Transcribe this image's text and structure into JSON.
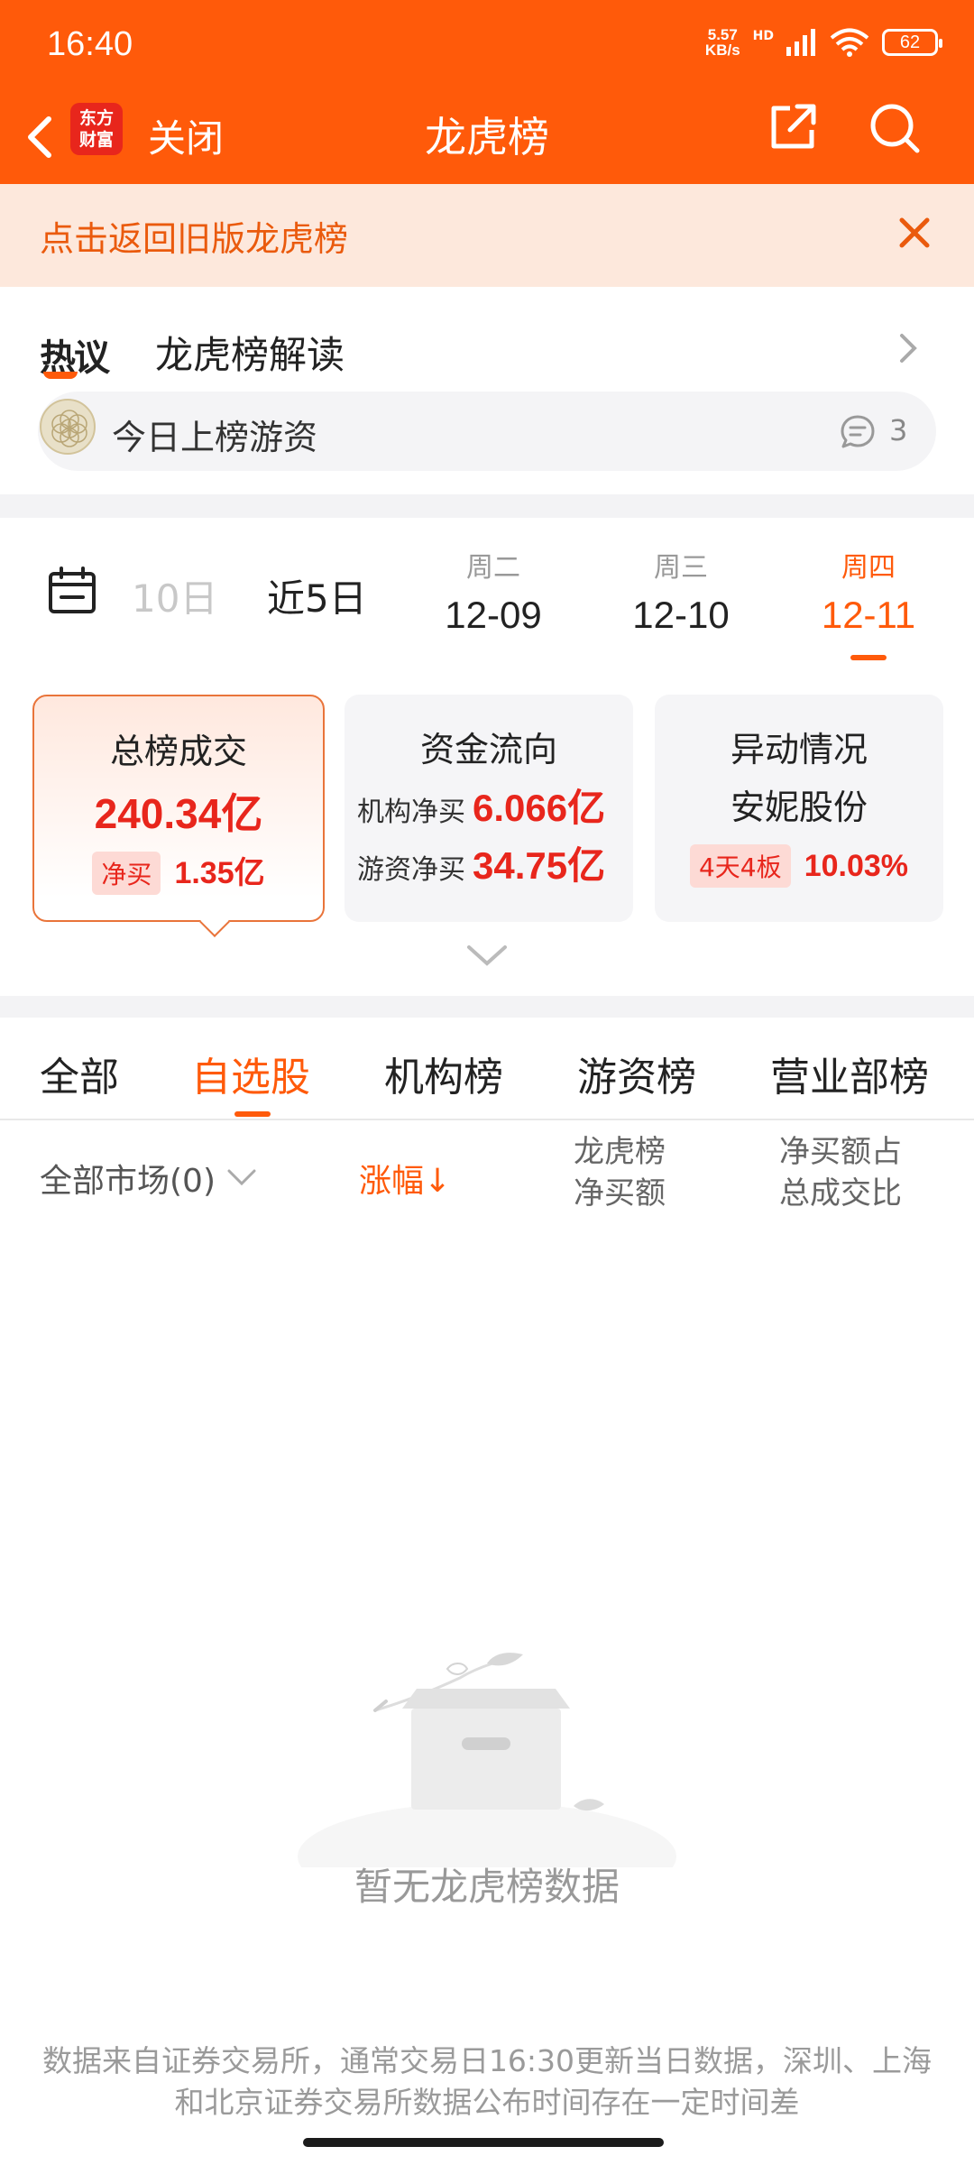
{
  "status": {
    "time": "16:40",
    "speed_value": "5.57",
    "speed_unit": "KB/s",
    "network": "HD",
    "battery": "62"
  },
  "nav": {
    "logo_line1": "东方",
    "logo_line2": "财富",
    "close_label": "关闭",
    "title": "龙虎榜"
  },
  "banner": {
    "text": "点击返回旧版龙虎榜"
  },
  "hot": {
    "badge": "热议",
    "title": "龙虎榜解读",
    "card_text": "今日上榜游资",
    "comment_count": "3"
  },
  "date_range": {
    "option_10": "10日",
    "option_5": "近5日"
  },
  "dates": [
    {
      "weekday": "周二",
      "date": "12-09",
      "active": false
    },
    {
      "weekday": "周三",
      "date": "12-10",
      "active": false
    },
    {
      "weekday": "周四",
      "date": "12-11",
      "active": true
    }
  ],
  "cards": {
    "total": {
      "title": "总榜成交",
      "amount": "240.34亿",
      "net_label": "净买",
      "net_value": "1.35亿"
    },
    "flow": {
      "title": "资金流向",
      "inst_label": "机构净买",
      "inst_value": "6.066亿",
      "hot_label": "游资净买",
      "hot_value": "34.75亿"
    },
    "abnormal": {
      "title": "异动情况",
      "stock": "安妮股份",
      "board_tag": "4天4板",
      "change": "10.03%"
    }
  },
  "tabs": [
    "全部",
    "自选股",
    "机构榜",
    "游资榜",
    "营业部榜"
  ],
  "active_tab": "自选股",
  "columns": {
    "market": "全部市场(0)",
    "sort": "涨幅↓",
    "col2_line1": "龙虎榜",
    "col2_line2": "净买额",
    "col3_line1": "净买额占",
    "col3_line2": "总成交比"
  },
  "empty_text": "暂无龙虎榜数据",
  "footer_note": "数据来自证券交易所，通常交易日16:30更新当日数据，深圳、上海和北京证券交易所数据公布时间存在一定时间差",
  "colors": {
    "brand_orange": "#ff5a0a",
    "accent_red": "#e8261c",
    "banner_bg": "#fde8dc"
  },
  "icons": [
    "back-arrow-icon",
    "share-icon",
    "search-icon",
    "close-icon",
    "chevron-right-icon",
    "comment-icon",
    "calendar-icon",
    "chevron-down-icon",
    "empty-box-icon"
  ]
}
